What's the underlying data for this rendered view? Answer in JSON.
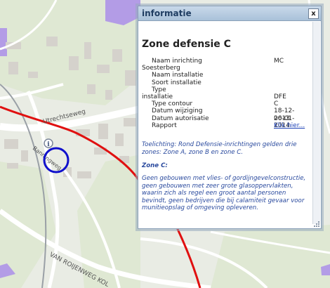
{
  "map": {
    "roads": [
      "Utrechtseweg",
      "Banningweg",
      "VAN ROIJENWEG KOL"
    ],
    "colors": {
      "background": "#e9ece4",
      "zone_line": "#e01010",
      "marker": "#1010cc",
      "purple_area": "#b39ce6"
    },
    "icons": [
      "info-marker-icon"
    ]
  },
  "popup": {
    "title": "informatie",
    "close_label": "x",
    "zone_title": "Zone defensie C",
    "properties": {
      "naam_inrichting_label": "Naam inrichting",
      "naam_inrichting_value": "MC",
      "naam_inrichting_cont": "Soesterberg",
      "naam_installatie_label": "Naam installatie",
      "soort_installatie_label": "Soort installatie",
      "type_label": "Type",
      "type_cont": "installatie",
      "type_value": "DFE",
      "type_contour_label": "Type contour",
      "type_contour_value": "C",
      "datum_wijziging_label": "Datum wijziging",
      "datum_wijziging_value": "18-12-2013",
      "datum_autorisatie_label": "Datum autorisatie",
      "datum_autorisatie_value": "06-01-2014",
      "rapport_label": "Rapport",
      "rapport_link": "Klik hier..."
    },
    "toelichting": "Toelichting: Rond Defensie-inrichtingen gelden drie zones: Zone A, zone B en zone C.",
    "zone_c_heading": "Zone C:",
    "zone_c_text": "Geen gebouwen met vlies- of gordijngevelconstructie, geen gebouwen met zeer grote glasoppervlakten, waarin zich als regel een groot aantal personen bevindt, geen bedrijven die bij calamiteit gevaar voor munitieopslag of omgeving opleveren."
  }
}
